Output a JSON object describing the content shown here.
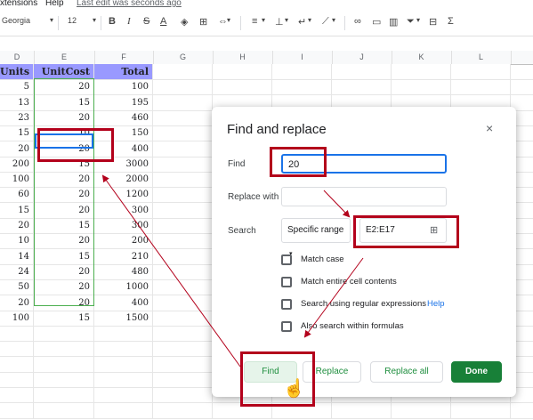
{
  "menubar": {
    "extensions": "xtensions",
    "help": "Help",
    "last_edit": "Last edit was seconds ago"
  },
  "toolbar": {
    "font": "Georgia",
    "size": "12",
    "bold": "B",
    "italic": "I",
    "strike": "S",
    "textcolor": "A"
  },
  "columns": [
    "D",
    "E",
    "F",
    "G",
    "H",
    "I",
    "J",
    "K",
    "L"
  ],
  "header_row": [
    "Units",
    "UnitCost",
    "Total"
  ],
  "rows": [
    [
      "5",
      "20",
      "100"
    ],
    [
      "13",
      "15",
      "195"
    ],
    [
      "23",
      "20",
      "460"
    ],
    [
      "15",
      "10",
      "150"
    ],
    [
      "20",
      "20",
      "400"
    ],
    [
      "200",
      "15",
      "3000"
    ],
    [
      "100",
      "20",
      "2000"
    ],
    [
      "60",
      "20",
      "1200"
    ],
    [
      "15",
      "20",
      "300"
    ],
    [
      "20",
      "15",
      "300"
    ],
    [
      "10",
      "20",
      "200"
    ],
    [
      "14",
      "15",
      "210"
    ],
    [
      "24",
      "20",
      "480"
    ],
    [
      "50",
      "20",
      "1000"
    ],
    [
      "20",
      "20",
      "400"
    ],
    [
      "100",
      "15",
      "1500"
    ]
  ],
  "dialog": {
    "title": "Find and replace",
    "close": "×",
    "find_label": "Find",
    "find_value": "20",
    "replace_label": "Replace with",
    "replace_value": "",
    "search_label": "Search",
    "search_scope": "Specific range",
    "range_value": "E2:E17",
    "options": [
      "Match case",
      "Match entire cell contents",
      "Search using regular expressions",
      "Also search within formulas"
    ],
    "help_link": "Help",
    "buttons": {
      "find": "Find",
      "replace": "Replace",
      "replace_all": "Replace all",
      "done": "Done"
    }
  },
  "colors": {
    "header_bg": "#9999ff",
    "accent_red": "#b3001b",
    "green": "#188038",
    "blue": "#1a73e8"
  }
}
